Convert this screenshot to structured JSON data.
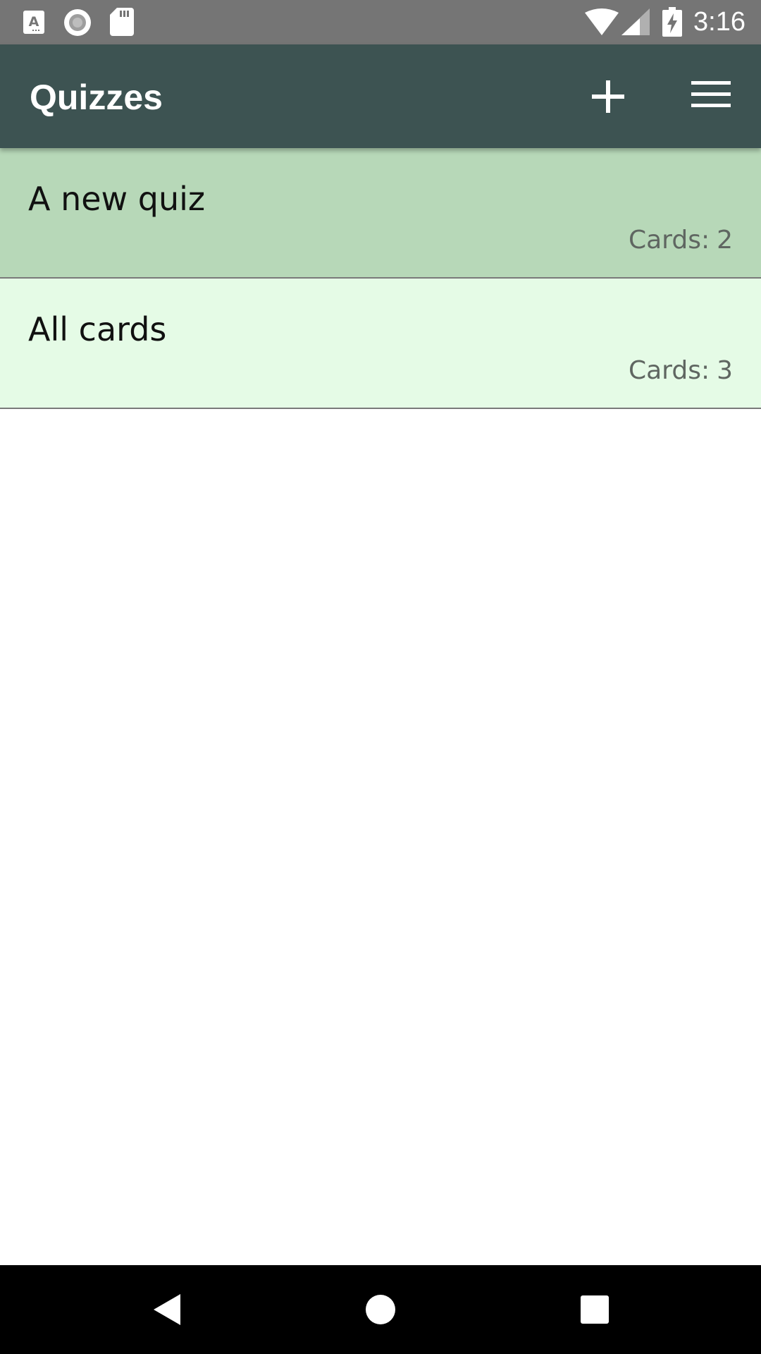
{
  "status_bar": {
    "time": "3:16",
    "icons": [
      "a-notification-icon",
      "record-icon",
      "sd-card-icon",
      "wifi-icon",
      "cell-signal-icon",
      "battery-charging-icon"
    ]
  },
  "app_bar": {
    "title": "Quizzes",
    "background_color": "#3d5352",
    "actions": [
      "add-icon",
      "menu-icon"
    ]
  },
  "quizzes": [
    {
      "name": "A new quiz",
      "count_label": "Cards:",
      "count": "2",
      "background_color": "#b7d8b8"
    },
    {
      "name": "All cards",
      "count_label": "Cards:",
      "count": "3",
      "background_color": "#e5fbe6"
    }
  ],
  "nav_bar": {
    "buttons": [
      "back-icon",
      "home-icon",
      "recents-icon"
    ]
  }
}
